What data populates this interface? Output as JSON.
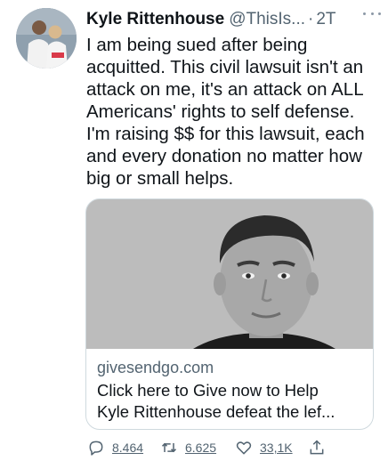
{
  "tweet": {
    "author_name": "Kyle Rittenhouse",
    "author_handle": "@ThisIs...",
    "separator": "·",
    "time": "2T",
    "text_lines": [
      "I am being sued after being",
      "acquitted. This civil lawsuit isn't an",
      "attack on me, it's an attack on ALL",
      "Americans' rights to self defense.",
      "I'm raising $$ for this lawsuit, each",
      "and every donation no matter how",
      "big or small helps."
    ]
  },
  "card": {
    "domain": "givesendgo.com",
    "title_lines": [
      "Click here to Give now to Help",
      "Kyle Rittenhouse defeat the lef..."
    ]
  },
  "actions": {
    "replies": "8.464",
    "retweets": "6.625",
    "likes": "33,1K"
  },
  "icons": {
    "reply": "reply-icon",
    "retweet": "retweet-icon",
    "like": "heart-icon",
    "share": "share-icon",
    "more": "more-icon"
  },
  "colors": {
    "text": "#0f1419",
    "secondary": "#536471",
    "border": "#cfd9de"
  }
}
